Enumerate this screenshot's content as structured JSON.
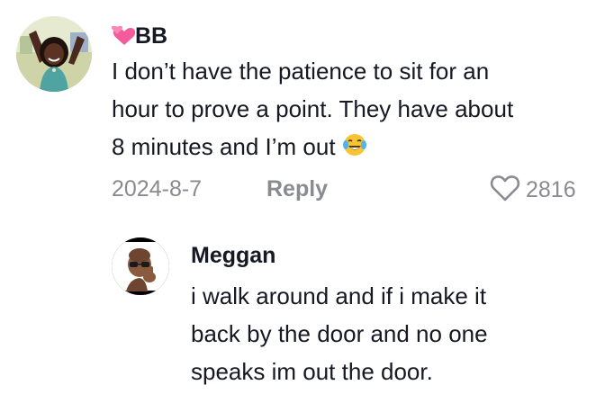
{
  "comments": [
    {
      "username": "BB",
      "name_emoji": "💕",
      "text_lines": [
        "I don’t have the patience to sit for an",
        "hour to prove a point. They have about",
        "8 minutes and I’m out"
      ],
      "text_emoji": "😂",
      "date": "2024-8-7",
      "reply_label": "Reply",
      "like_count": "2816",
      "avatar_icon": "woman-celebrating-avatar"
    },
    {
      "username": "Meggan",
      "text_lines": [
        "i walk around and if i make it",
        "back by the door and no one",
        "speaks im out the door."
      ],
      "avatar_icon": "memoji-sunglasses-avatar"
    }
  ],
  "colors": {
    "primary_text": "#161823",
    "secondary_text": "#8a8b91",
    "name_emoji_pink": "#f45b9a"
  }
}
